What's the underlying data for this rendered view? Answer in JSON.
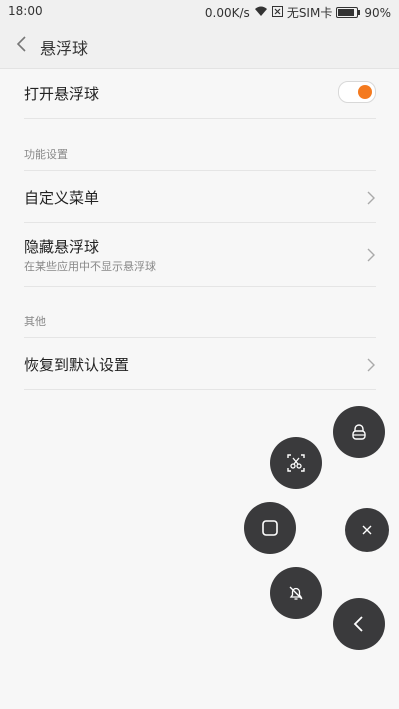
{
  "status_bar": {
    "time": "18:00",
    "speed": "0.00K/s",
    "sim": "无SIM卡",
    "battery": "90%",
    "battery_level": 0.9
  },
  "header": {
    "title": "悬浮球"
  },
  "settings": {
    "open_float_ball": {
      "label": "打开悬浮球",
      "enabled": true
    },
    "section_function": "功能设置",
    "custom_menu": {
      "label": "自定义菜单"
    },
    "hide_float_ball": {
      "label": "隐藏悬浮球",
      "sub": "在某些应用中不显示悬浮球"
    },
    "section_other": "其他",
    "restore_default": {
      "label": "恢复到默认设置"
    }
  },
  "float_menu": {
    "items": [
      {
        "icon": "lock-screen-icon"
      },
      {
        "icon": "screenshot-icon"
      },
      {
        "icon": "recent-apps-icon"
      },
      {
        "icon": "close-icon"
      },
      {
        "icon": "mute-icon"
      },
      {
        "icon": "back-icon"
      }
    ]
  },
  "colors": {
    "accent": "#f47a1f",
    "fab_bg": "#3a3a3c",
    "background": "#f7f7f7"
  }
}
